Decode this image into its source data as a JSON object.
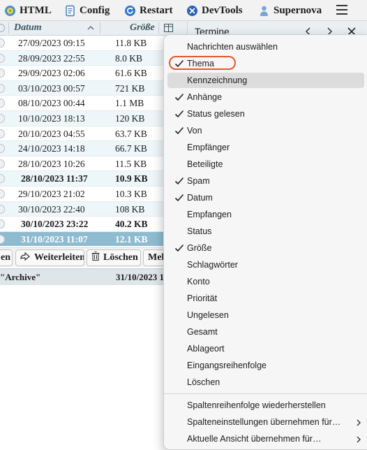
{
  "toolbar": {
    "html_label": "HTML",
    "config_label": "Config",
    "restart_label": "Restart",
    "devtools_label": "DevTools",
    "supernova_label": "Supernova"
  },
  "colors": {
    "selected_row": "#8fbbd0",
    "menu_highlight_ring": "#e4572e",
    "alt_row": "#edf6f9"
  },
  "list": {
    "columns": {
      "date": "Datum",
      "size": "Größe"
    },
    "rows": [
      {
        "date": "27/09/2023 09:15",
        "size": "11.8 KB"
      },
      {
        "date": "28/09/2023 22:55",
        "size": "8.0 KB"
      },
      {
        "date": "29/09/2023 02:06",
        "size": "61.6 KB"
      },
      {
        "date": "03/10/2023 00:57",
        "size": "721 KB"
      },
      {
        "date": "08/10/2023 00:44",
        "size": "1.1 MB"
      },
      {
        "date": "10/10/2023 18:13",
        "size": "120 KB"
      },
      {
        "date": "20/10/2023 04:55",
        "size": "63.7 KB"
      },
      {
        "date": "24/10/2023 14:18",
        "size": "66.7 KB"
      },
      {
        "date": "28/10/2023 10:26",
        "size": "11.5 KB"
      },
      {
        "date": "28/10/2023 11:37",
        "size": "10.9 KB"
      },
      {
        "date": "29/10/2023 21:02",
        "size": "10.3 KB"
      },
      {
        "date": "30/10/2023 22:40",
        "size": "108 KB"
      },
      {
        "date": "30/10/2023 23:22",
        "size": "40.2 KB"
      },
      {
        "date": "31/10/2023 11:07",
        "size": "12.1 KB"
      }
    ]
  },
  "actions": {
    "reply_label": "en",
    "forward_label": "Weiterleiten",
    "delete_label": "Löschen",
    "more_label": "Meh"
  },
  "status": {
    "folder": "\"Archive\"",
    "date": "31/10/2023 1"
  },
  "calendar": {
    "title": "Termine"
  },
  "menu": {
    "items": [
      {
        "label": "Nachrichten auswählen",
        "checked": false
      },
      {
        "label": "Thema",
        "checked": true
      },
      {
        "label": "Kennzeichnung",
        "checked": false
      },
      {
        "label": "Anhänge",
        "checked": true
      },
      {
        "label": "Status gelesen",
        "checked": true
      },
      {
        "label": "Von",
        "checked": true
      },
      {
        "label": "Empfänger",
        "checked": false
      },
      {
        "label": "Beteiligte",
        "checked": false
      },
      {
        "label": "Spam",
        "checked": true
      },
      {
        "label": "Datum",
        "checked": true
      },
      {
        "label": "Empfangen",
        "checked": false
      },
      {
        "label": "Status",
        "checked": false
      },
      {
        "label": "Größe",
        "checked": true
      },
      {
        "label": "Schlagwörter",
        "checked": false
      },
      {
        "label": "Konto",
        "checked": false
      },
      {
        "label": "Priorität",
        "checked": false
      },
      {
        "label": "Ungelesen",
        "checked": false
      },
      {
        "label": "Gesamt",
        "checked": false
      },
      {
        "label": "Ablageort",
        "checked": false
      },
      {
        "label": "Eingangsreihenfolge",
        "checked": false
      },
      {
        "label": "Löschen",
        "checked": false
      }
    ],
    "footer_items": [
      {
        "label": "Spaltenreihenfolge wiederherstellen",
        "submenu": false
      },
      {
        "label": "Spalteneinstellungen übernehmen für…",
        "submenu": true
      },
      {
        "label": "Aktuelle Ansicht übernehmen für…",
        "submenu": true
      }
    ]
  }
}
